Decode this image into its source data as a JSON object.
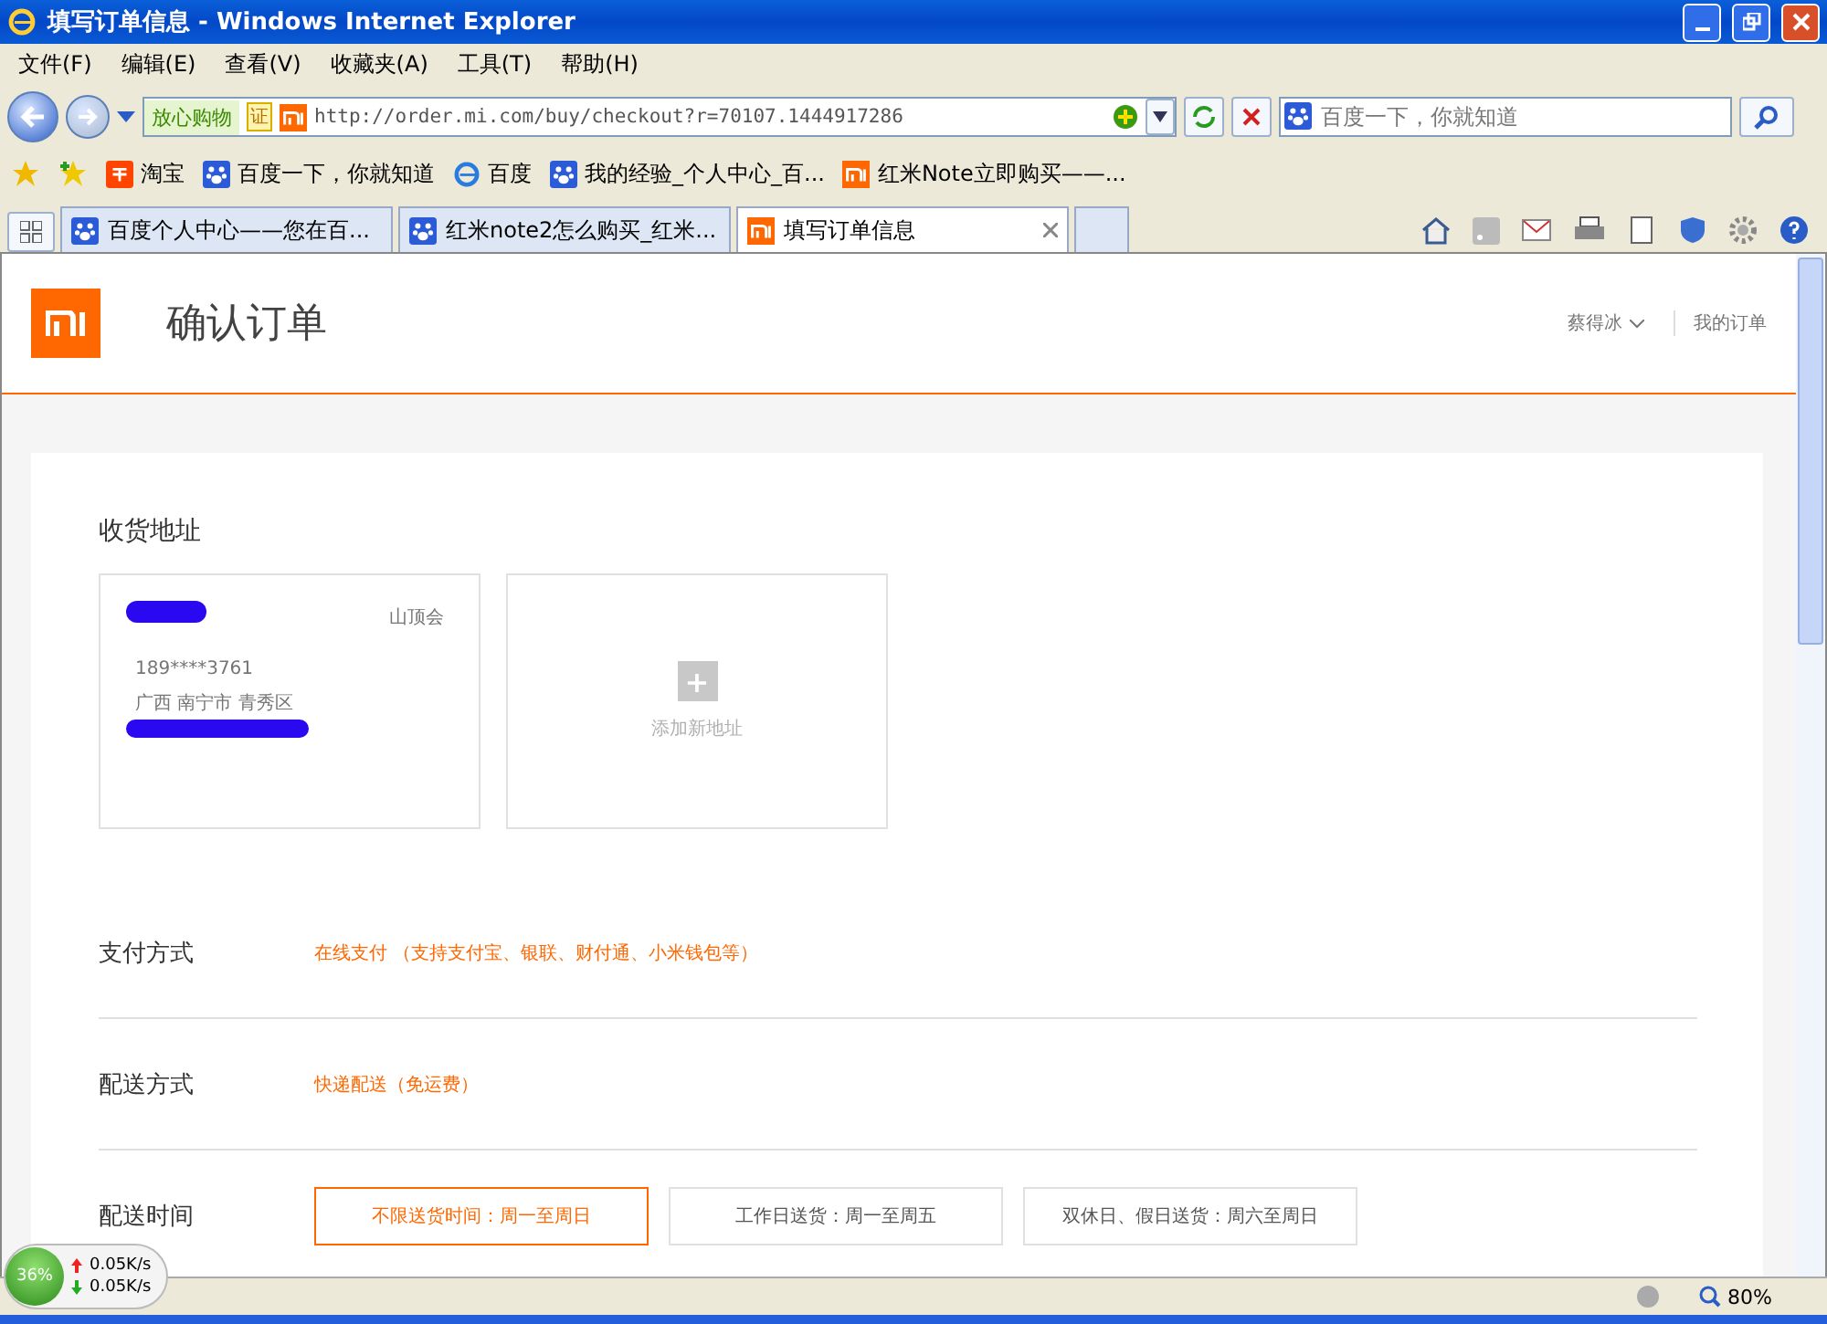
{
  "window": {
    "title": "填写订单信息 - Windows Internet Explorer"
  },
  "menu": [
    "文件(F)",
    "编辑(E)",
    "查看(V)",
    "收藏夹(A)",
    "工具(T)",
    "帮助(H)"
  ],
  "address_bar": {
    "badge": "放心购物",
    "cert": "证",
    "url": "http://order.mi.com/buy/checkout?r=70107.1444917286"
  },
  "search": {
    "placeholder": "百度一下，你就知道"
  },
  "favorites": [
    {
      "label": "淘宝",
      "kind": "taobao"
    },
    {
      "label": "百度一下，你就知道",
      "kind": "paw"
    },
    {
      "label": "百度",
      "kind": "ie"
    },
    {
      "label": "我的经验_个人中心_百...",
      "kind": "paw"
    },
    {
      "label": "红米Note立即购买——...",
      "kind": "mi"
    }
  ],
  "tabs": [
    {
      "label": "百度个人中心——您在百...",
      "kind": "paw",
      "selected": false
    },
    {
      "label": "红米note2怎么购买_红米...",
      "kind": "paw",
      "selected": false
    },
    {
      "label": "填写订单信息",
      "kind": "mi",
      "selected": true
    }
  ],
  "page": {
    "title": "确认订单",
    "user": "蔡得冰",
    "orders_link": "我的订单",
    "address_heading": "收货地址",
    "address": {
      "tag": "山顶会",
      "phone": "189****3761",
      "region": "广西 南宁市 青秀区"
    },
    "add_address": {
      "icon": "+",
      "label": "添加新地址"
    },
    "sections": [
      {
        "label": "支付方式",
        "value": "在线支付 （支持支付宝、银联、财付通、小米钱包等）"
      },
      {
        "label": "配送方式",
        "value": "快递配送（免运费）"
      }
    ],
    "delivery": {
      "label": "配送时间",
      "options": [
        {
          "label": "不限送货时间：周一至周日",
          "selected": true
        },
        {
          "label": "工作日送货：周一至周五",
          "selected": false
        },
        {
          "label": "双休日、假日送货：周六至周日",
          "selected": false
        }
      ]
    }
  },
  "net_widget": {
    "percent": "36%",
    "up": "0.05K/s",
    "down": "0.05K/s"
  },
  "status_bar": {
    "zoom": "80%"
  }
}
